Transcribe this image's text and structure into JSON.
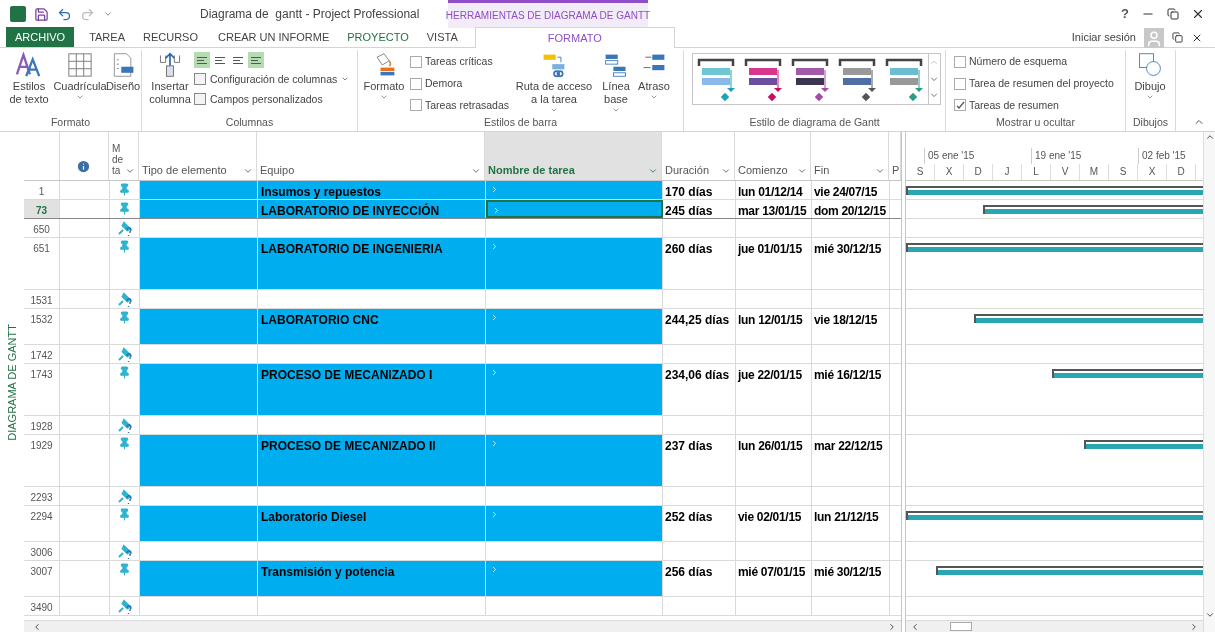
{
  "window": {
    "title": "Diagrama de  gantt - Project Professional",
    "context_tab_title": "HERRAMIENTAS DE DIAGRAMA DE GANTT",
    "help": "?",
    "sign_in": "Iniciar sesión"
  },
  "tabs": [
    {
      "label": "ARCHIVO",
      "kind": "file",
      "selected": false
    },
    {
      "label": "TAREA",
      "kind": "tab",
      "selected": false
    },
    {
      "label": "RECURSO",
      "kind": "tab",
      "selected": false
    },
    {
      "label": "CREAR UN INFORME",
      "kind": "tab",
      "selected": false
    },
    {
      "label": "PROYECTO",
      "kind": "accent",
      "selected": false
    },
    {
      "label": "VISTA",
      "kind": "tab",
      "selected": false
    },
    {
      "label": "FORMATO",
      "kind": "context",
      "selected": true
    }
  ],
  "ribbon": {
    "groups": [
      {
        "label": "Formato",
        "buttons": [
          {
            "label": "Estilos de texto",
            "dropdown": false
          },
          {
            "label": "Cuadrícula",
            "dropdown": true
          },
          {
            "label": "Diseño",
            "dropdown": false
          }
        ]
      },
      {
        "label": "Columnas",
        "buttons": [
          {
            "label": "Insertar columna",
            "dropdown": false
          }
        ],
        "align_buttons": [
          {
            "selected": true
          },
          {
            "selected": false
          },
          {
            "selected": false
          },
          {
            "selected": true
          }
        ],
        "menu": [
          {
            "label": "Configuración de columnas",
            "dropdown": true
          },
          {
            "label": "Campos personalizados",
            "dropdown": false
          }
        ]
      },
      {
        "label": "Estilos de barra",
        "buttons": [
          {
            "label": "Formato",
            "dropdown": true
          }
        ],
        "checks": [
          {
            "label": "Tareas críticas",
            "checked": false
          },
          {
            "label": "Demora",
            "checked": false
          },
          {
            "label": "Tareas retrasadas",
            "checked": false
          }
        ],
        "buttons2": [
          {
            "label": "Ruta de acceso a la tarea",
            "dropdown": true
          },
          {
            "label": "Línea base",
            "dropdown": true
          },
          {
            "label": "Atraso",
            "dropdown": true
          }
        ]
      },
      {
        "label": "Estilo de diagrama de Gantt"
      },
      {
        "label": "Mostrar u ocultar",
        "checks": [
          {
            "label": "Número de esquema",
            "checked": false
          },
          {
            "label": "Tarea de resumen del proyecto",
            "checked": false
          },
          {
            "label": "Tareas de resumen",
            "checked": true
          }
        ]
      },
      {
        "label": "Dibujos",
        "buttons": [
          {
            "label": "Dibujo",
            "dropdown": true
          }
        ]
      }
    ]
  },
  "side_label": "DIAGRAMA DE GANTT",
  "table": {
    "columns": [
      {
        "label": "M de ta",
        "filter": true
      },
      {
        "label": "Tipo de elemento",
        "filter": true
      },
      {
        "label": "Equipo",
        "filter": true
      },
      {
        "label": "Nombre de tarea",
        "filter": true,
        "selected": true
      },
      {
        "label": "Duración",
        "filter": true
      },
      {
        "label": "Comienzo",
        "filter": true
      },
      {
        "label": "Fin",
        "filter": true
      },
      {
        "label": "P",
        "filter": false
      }
    ],
    "rows": [
      {
        "id": "1",
        "kind": "short",
        "selected": false,
        "name": "Insumos y repuestos",
        "duration": "170 días",
        "start": "lun 01/12/14",
        "end": "vie 24/07/15",
        "level": 1
      },
      {
        "id": "73",
        "kind": "short",
        "selected": true,
        "name": "LABORATORIO DE INYECCIÓN",
        "duration": "245 días",
        "start": "mar 13/01/15",
        "end": "dom 20/12/15",
        "level": 0.74
      },
      {
        "id": "650",
        "kind": "blank",
        "selected": false
      },
      {
        "id": "651",
        "kind": "tall",
        "selected": false,
        "name": "LABORATORIO DE INGENIERIA",
        "duration": "260 días",
        "start": "jue 01/01/15",
        "end": "mié 30/12/15",
        "level": 1
      },
      {
        "id": "1531",
        "kind": "blank",
        "selected": false
      },
      {
        "id": "1532",
        "kind": "medium",
        "selected": false,
        "name": "LABORATORIO CNC",
        "duration": "244,25 días",
        "start": "lun 12/01/15",
        "end": "vie 18/12/15",
        "level": 0.77
      },
      {
        "id": "1742",
        "kind": "blank",
        "selected": false
      },
      {
        "id": "1743",
        "kind": "tall",
        "selected": false,
        "name": "PROCESO DE MECANIZADO I",
        "duration": "234,06 días",
        "start": "jue 22/01/15",
        "end": "mié 16/12/15",
        "level": 0.51
      },
      {
        "id": "1928",
        "kind": "blank",
        "selected": false
      },
      {
        "id": "1929",
        "kind": "tall",
        "selected": false,
        "name": "PROCESO DE MECANIZADO II",
        "duration": "237 días",
        "start": "lun 26/01/15",
        "end": "mar 22/12/15",
        "level": 0.4
      },
      {
        "id": "2293",
        "kind": "blank",
        "selected": false
      },
      {
        "id": "2294",
        "kind": "medium",
        "selected": false,
        "name": "Laboratorio Diesel",
        "duration": "252 días",
        "start": "vie 02/01/15",
        "end": "lun 21/12/15",
        "level": 1
      },
      {
        "id": "3006",
        "kind": "blank",
        "selected": false
      },
      {
        "id": "3007",
        "kind": "medium",
        "selected": false,
        "name": "Transmisión y potencia",
        "duration": "256 días",
        "start": "mié 07/01/15",
        "end": "mié 30/12/15",
        "level": 0.9
      },
      {
        "id": "3490",
        "kind": "blank",
        "selected": false
      }
    ]
  },
  "gantt": {
    "weeks": [
      "05 ene '15",
      "19 ene '15",
      "02 feb '15"
    ],
    "days": [
      "S",
      "X",
      "D",
      "J",
      "L",
      "V",
      "M",
      "S",
      "X",
      "D"
    ]
  }
}
